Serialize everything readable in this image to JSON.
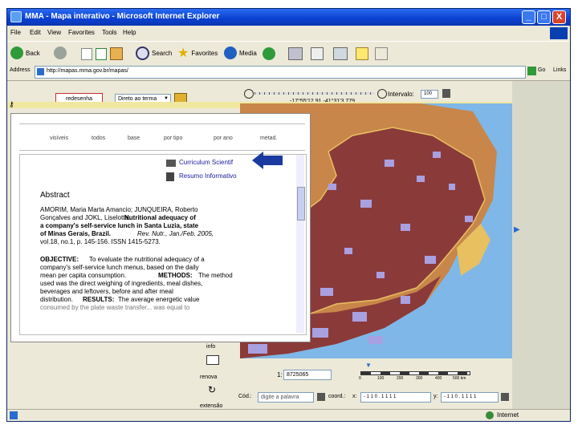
{
  "window": {
    "title": "MMA - Mapa interativo - Microsoft Internet Explorer",
    "minimize": "_",
    "maximize": "□",
    "close": "X"
  },
  "menu": [
    "File",
    "Edit",
    "View",
    "Favorites",
    "Tools",
    "Help"
  ],
  "toolbar": {
    "back_label": "Back",
    "search_label": "Search",
    "favorites_label": "Favorites",
    "media_label": "Media"
  },
  "address": {
    "label": "Address",
    "url": "http://mapas.mma.gov.br/mapas/",
    "go_label": "Go",
    "links_label": "Links"
  },
  "app_toolbar": {
    "button_label": "redesenha",
    "select_value": "Direto ao terma",
    "interval_label": "Intervalo:",
    "interval_value": "100",
    "coordinates": "-17°55'12.91 -41°31'3.779"
  },
  "popup": {
    "tabs": [
      "visíveis",
      "todos",
      "base",
      "por tipo",
      "por ano",
      "metad."
    ],
    "link1": "Curriculum Scientif",
    "link2": "Resumo Informativo",
    "abstract_heading": "Abstract",
    "ref_lines": [
      "AMORIM, Maria Marta Amancio; JUNQUEIRA, Roberto",
      "Gonçalves and JOKL, Liselotte.",
      "a company's self-service lunch in Santa Luzia, state",
      "of Minas Gerais, Brazil.",
      "vol.18, no.1, p. 145-156. ISSN 1415-5273."
    ],
    "ref_bold_1": "Nutritional adequacy of",
    "ref_journal": "Rev. Nutr., Jan./Feb. 2005,",
    "body_lines": [
      "To evaluate the nutritional adequacy of a",
      "company's self-service lunch menus, based on the daily",
      "mean per capita consumption.",
      "used was the direct weighing of ingredients, meal dishes,",
      "beverages and leftovers, before and after meal",
      "distribution.",
      "consumed by the plate waste transfer... was equal to"
    ],
    "objective_label": "OBJECTIVE:",
    "methods_label": "METHODS:",
    "methods_rest": "The method",
    "results_label": "RESULTS:",
    "results_rest": "The average energetic value"
  },
  "lower_tools": {
    "info_label": "info",
    "refresh_label": "renova",
    "extent_label": "extensão",
    "scale_prefix": "1:",
    "scale_value": "8725065",
    "scale_ticks": [
      "0",
      "100",
      "200",
      "300",
      "400",
      "500 km"
    ],
    "search_label": "Cód.:",
    "search_placeholder": "digite a palavra",
    "coords_label": "coord.:",
    "x_label": "x:",
    "y_label": "y:",
    "x_value": "- 1 1 0 . 1 1 1 1",
    "y_value": "- 1 1 0 . 1 1 1 1"
  },
  "status": {
    "zone": "Internet"
  },
  "colors": {
    "ocean": "#7fb7e8",
    "state_fill": "#8b3a3a",
    "neighbor_fill": "#c8864a",
    "dots": "#a9a0e0",
    "highlight": "#e8c060",
    "arrow": "#1a3aa0"
  }
}
